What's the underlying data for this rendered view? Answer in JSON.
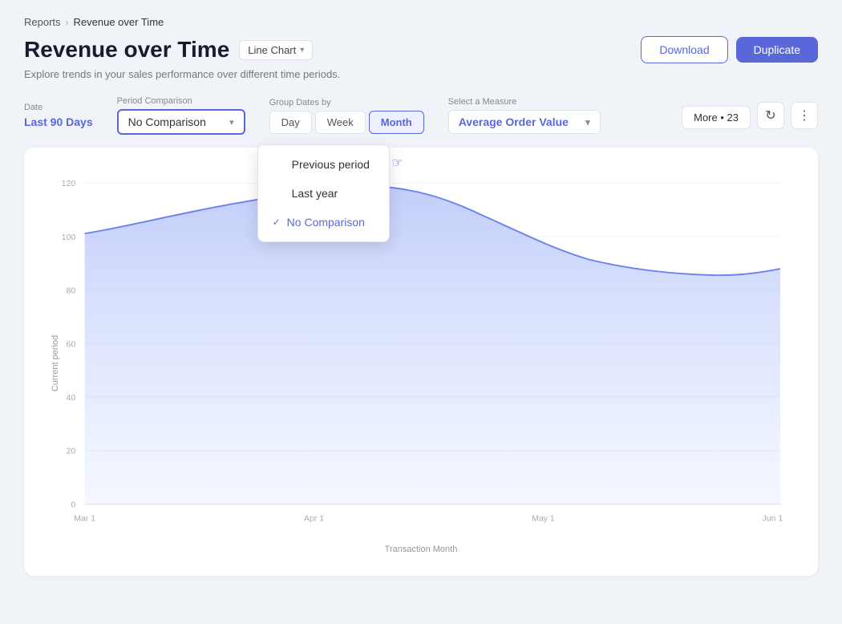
{
  "breadcrumb": {
    "parent": "Reports",
    "current": "Revenue over Time",
    "separator": "›"
  },
  "header": {
    "title": "Revenue over Time",
    "subtitle": "Explore trends in your sales performance over different time periods.",
    "chart_type_label": "Line Chart",
    "download_label": "Download",
    "duplicate_label": "Duplicate"
  },
  "controls": {
    "date_label": "Date",
    "date_value": "Last 90 Days",
    "period_label": "Period Comparison",
    "period_value": "No Comparison",
    "group_label": "Group Dates by",
    "group_options": [
      "Day",
      "Week",
      "Month"
    ],
    "group_active": "Month",
    "measure_label": "Select a Measure",
    "measure_value": "Average Order Value",
    "more_label": "More",
    "more_count": "23"
  },
  "dropdown": {
    "items": [
      {
        "label": "Previous period",
        "checked": false
      },
      {
        "label": "Last year",
        "checked": false
      },
      {
        "label": "No Comparison",
        "checked": true
      }
    ]
  },
  "chart": {
    "y_label": "Current period",
    "x_label": "Transaction Month",
    "y_ticks": [
      "0",
      "20",
      "40",
      "60",
      "80",
      "100",
      "120"
    ],
    "x_ticks": [
      "Mar 1",
      "Apr 1",
      "May 1",
      "Jun 1"
    ]
  },
  "icons": {
    "chevron_down": "▾",
    "check": "✓",
    "refresh": "↻",
    "more_vert": "⋮",
    "cursor": "🖱"
  }
}
